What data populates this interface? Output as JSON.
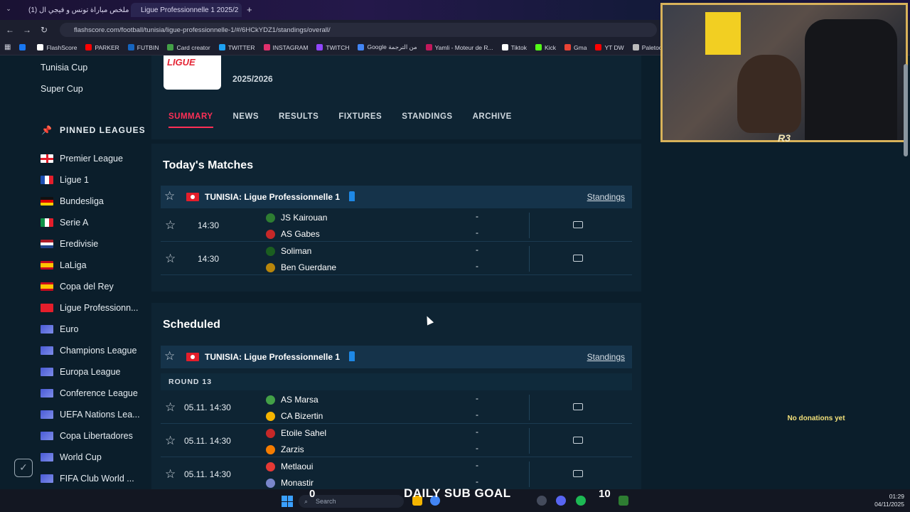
{
  "browser": {
    "tabs": [
      {
        "label": "(1) ملخص مباراة تونس و فيجي ال",
        "color": "#e53935"
      },
      {
        "label": "Ligue Professionnelle 1 2025/2",
        "color": "#1e88e5"
      }
    ],
    "url": "flashscore.com/football/tunisia/ligue-professionnelle-1/#/6HCkYDZ1/standings/overall/",
    "bookmarks": [
      {
        "label": "",
        "color": "#1877f2"
      },
      {
        "label": "FlashScore",
        "color": "#ffffff"
      },
      {
        "label": "PARKER",
        "color": "#ff0000"
      },
      {
        "label": "FUTBIN",
        "color": "#1565c0"
      },
      {
        "label": "Card creator",
        "color": "#43a047"
      },
      {
        "label": "TWITTER",
        "color": "#1da1f2"
      },
      {
        "label": "INSTAGRAM",
        "color": "#e1306c"
      },
      {
        "label": "TWITCH",
        "color": "#9146ff"
      },
      {
        "label": "Google من الترجمة",
        "color": "#4285f4"
      },
      {
        "label": "Yamli - Moteur de R...",
        "color": "#c2185b"
      },
      {
        "label": "Tiktok",
        "color": "#ffffff"
      },
      {
        "label": "Kick",
        "color": "#53fc18"
      },
      {
        "label": "Gma",
        "color": "#ea4335"
      },
      {
        "label": "YT DW",
        "color": "#ff0000"
      },
      {
        "label": "Paletools v25.1.1",
        "color": "#bbbbbb"
      }
    ]
  },
  "sidebar": {
    "top_items": [
      "Tunisia Cup",
      "Super Cup"
    ],
    "pinned_heading": "PINNED LEAGUES",
    "pinned": [
      {
        "label": "Premier League",
        "flag": "eng"
      },
      {
        "label": "Ligue 1",
        "flag": "fra"
      },
      {
        "label": "Bundesliga",
        "flag": "ger"
      },
      {
        "label": "Serie A",
        "flag": "ita"
      },
      {
        "label": "Eredivisie",
        "flag": "ned"
      },
      {
        "label": "LaLiga",
        "flag": "esp"
      },
      {
        "label": "Copa del Rey",
        "flag": "esp"
      },
      {
        "label": "Ligue Professionn...",
        "flag": "tun"
      },
      {
        "label": "Euro",
        "flag": "world"
      },
      {
        "label": "Champions League",
        "flag": "world"
      },
      {
        "label": "Europa League",
        "flag": "world"
      },
      {
        "label": "Conference League",
        "flag": "world"
      },
      {
        "label": "UEFA Nations Lea...",
        "flag": "world"
      },
      {
        "label": "Copa Libertadores",
        "flag": "world"
      },
      {
        "label": "World Cup",
        "flag": "world"
      },
      {
        "label": "FIFA Club World ...",
        "flag": "world"
      }
    ]
  },
  "header": {
    "logo_text": "LIGUE",
    "season": "2025/2026",
    "tabs": [
      "SUMMARY",
      "NEWS",
      "RESULTS",
      "FIXTURES",
      "STANDINGS",
      "ARCHIVE"
    ]
  },
  "today": {
    "title": "Today's Matches",
    "league": "TUNISIA: Ligue Professionnelle 1",
    "standings": "Standings",
    "matches": [
      {
        "time": "14:30",
        "home": "JS Kairouan",
        "away": "AS Gabes",
        "home_score": "-",
        "away_score": "-"
      },
      {
        "time": "14:30",
        "home": "Soliman",
        "away": "Ben Guerdane",
        "home_score": "-",
        "away_score": "-"
      }
    ]
  },
  "scheduled": {
    "title": "Scheduled",
    "league": "TUNISIA: Ligue Professionnelle 1",
    "standings": "Standings",
    "round": "ROUND 13",
    "matches": [
      {
        "time": "05.11. 14:30",
        "home": "AS Marsa",
        "away": "CA Bizertin",
        "home_score": "-",
        "away_score": "-"
      },
      {
        "time": "05.11. 14:30",
        "home": "Etoile Sahel",
        "away": "Zarzis",
        "home_score": "-",
        "away_score": "-"
      },
      {
        "time": "05.11. 14:30",
        "home": "Metlaoui",
        "away": "Monastir",
        "home_score": "-",
        "away_score": "-"
      }
    ]
  },
  "stream": {
    "donations": "No donations yet",
    "sub_goal_label": "DAILY SUB GOAL",
    "sub_current": "0",
    "sub_target": "10",
    "cam_badge": "R3"
  },
  "taskbar": {
    "search_placeholder": "Search",
    "time": "01:29",
    "date": "04/11/2025"
  }
}
